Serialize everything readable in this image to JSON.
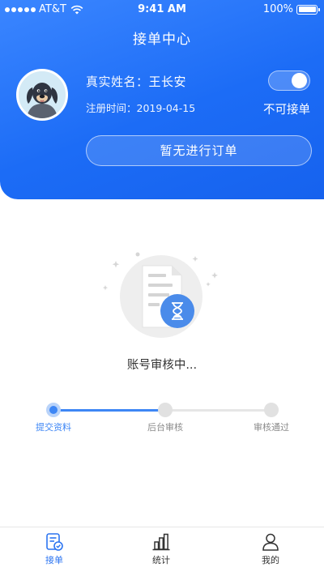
{
  "status_bar": {
    "carrier": "AT&T",
    "time": "9:41 AM",
    "battery": "100%"
  },
  "header": {
    "title": "接单中心",
    "name_label": "真实姓名：",
    "name_value": "王长安",
    "reg_label": "注册时间：",
    "reg_value": "2019-04-15",
    "toggle_label": "不可接单",
    "order_button": "暂无进行订单"
  },
  "main": {
    "status_text": "账号审核中..."
  },
  "progress": {
    "completed_fraction": 0.5,
    "steps": [
      {
        "label": "提交资料",
        "state": "active"
      },
      {
        "label": "后台审核",
        "state": "pending"
      },
      {
        "label": "审核通过",
        "state": "pending"
      }
    ]
  },
  "tab_bar": {
    "tabs": [
      {
        "label": "接单",
        "icon": "order-icon",
        "active": true
      },
      {
        "label": "统计",
        "icon": "stats-icon",
        "active": false
      },
      {
        "label": "我的",
        "icon": "profile-icon",
        "active": false
      }
    ]
  },
  "colors": {
    "primary": "#1c6cf6",
    "active_step": "#3d86f5",
    "inactive": "#e1e1e1"
  }
}
